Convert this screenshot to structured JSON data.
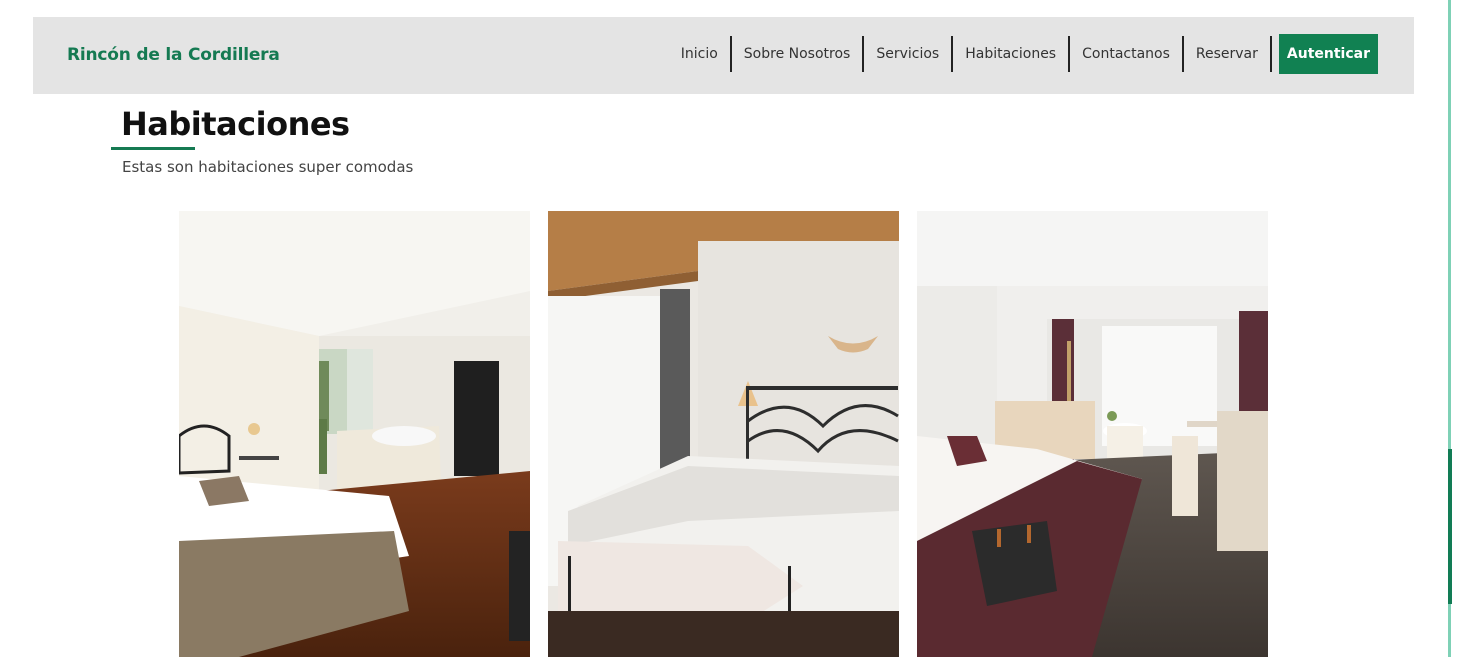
{
  "header": {
    "brand": "Rincón de la Cordillera",
    "nav": [
      {
        "label": "Inicio"
      },
      {
        "label": "Sobre Nosotros"
      },
      {
        "label": "Servicios"
      },
      {
        "label": "Habitaciones"
      },
      {
        "label": "Contactanos"
      },
      {
        "label": "Reservar"
      }
    ],
    "auth_label": "Autenticar"
  },
  "main": {
    "title": "Habitaciones",
    "subtitle": "Estas son habitaciones super comodas",
    "rooms": [
      {
        "image": "room-photo-bathtub"
      },
      {
        "image": "room-photo-iron-bed"
      },
      {
        "image": "room-photo-suite"
      }
    ]
  },
  "colors": {
    "brand_green": "#157a52",
    "button_green": "#118152",
    "navbar_bg": "#e4e4e4",
    "scrollbar_track": "#7fd1b6",
    "scrollbar_thumb": "#127c55"
  }
}
